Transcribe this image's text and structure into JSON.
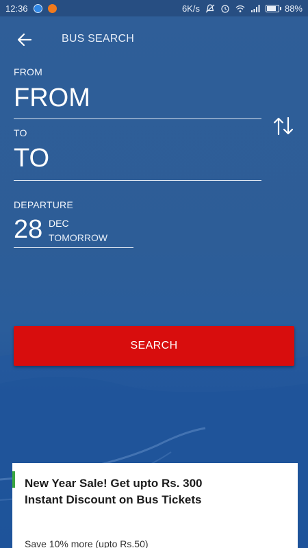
{
  "status_bar": {
    "time": "12:36",
    "network_speed": "6K/s",
    "battery_percent": "88%",
    "battery_level": 0.88,
    "icons": [
      "notification-blue-icon",
      "app-orange-icon",
      "silent-bell-icon",
      "alarm-icon",
      "wifi-icon",
      "signal-icon",
      "battery-icon"
    ]
  },
  "header": {
    "title": "BUS SEARCH",
    "back_icon": "arrow-left-icon"
  },
  "form": {
    "from_label": "FROM",
    "from_value": "FROM",
    "to_label": "TO",
    "to_value": "TO",
    "swap_icon": "swap-vertical-icon",
    "departure_label": "DEPARTURE",
    "departure_day": "28",
    "departure_month": "DEC",
    "departure_relative": "TOMORROW"
  },
  "search_button": {
    "label": "SEARCH"
  },
  "offer": {
    "title": "New Year Sale! Get upto Rs. 300 Instant Discount on Bus Tickets",
    "subtitle": "Save 10% more (upto Rs.50)",
    "accent_color": "#3aa640"
  },
  "colors": {
    "background": "#2d5d97",
    "status_bar": "#274e82",
    "search_button": "#d80d0d"
  }
}
